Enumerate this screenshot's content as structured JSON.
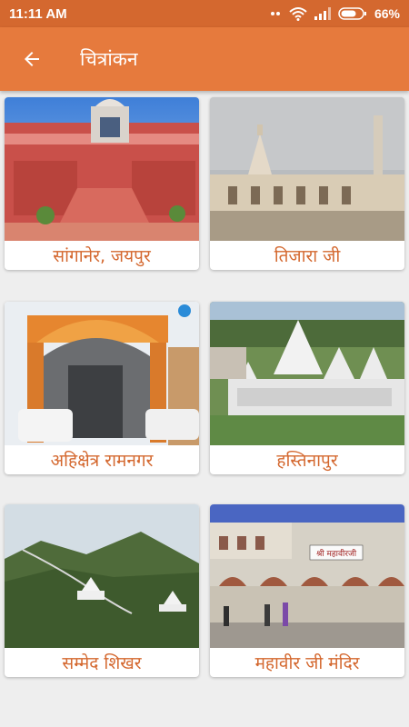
{
  "status_bar": {
    "time": "11:11 AM",
    "battery_percent": "66%",
    "icons": [
      "dots-icon",
      "wifi-icon",
      "signal-icon",
      "battery-icon"
    ]
  },
  "app_bar": {
    "title": "चित्रांकन",
    "back_icon": "arrow-back-icon"
  },
  "colors": {
    "status_bar": "#d4682f",
    "app_bar": "#e67a3d",
    "label_text": "#d4682f"
  },
  "gallery": {
    "items": [
      {
        "label": "सांगानेर, जयपुर"
      },
      {
        "label": "तिजारा जी"
      },
      {
        "label": "अहिक्षेत्र रामनगर"
      },
      {
        "label": "हस्तिनापुर"
      },
      {
        "label": "सम्मेद शिखर"
      },
      {
        "label": "महावीर जी मंदिर",
        "sign_text": "श्री महावीरजी"
      }
    ]
  }
}
